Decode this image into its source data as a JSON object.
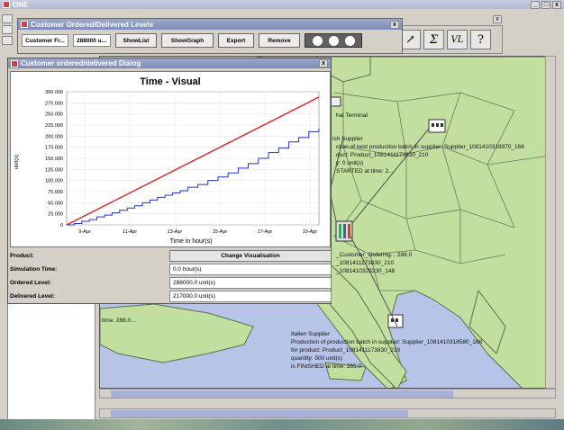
{
  "main_window": {
    "title": "ONE"
  },
  "toolbar_icons": [
    "↗",
    "Σ",
    "VL",
    "?"
  ],
  "customer_window": {
    "title": "Customer Ordered/Delivered Levels",
    "field1": "Customer Fr...",
    "field2": "288000 u...",
    "buttons": [
      "ShowList",
      "ShowGraph",
      "Export",
      "Remove"
    ]
  },
  "dialog": {
    "title": "Customer ordered/delivered Dialog",
    "fields": [
      {
        "label": "Product:",
        "value": "Change Visualisation"
      },
      {
        "label": "Simulation Time:",
        "value": "0.0 hour(s)"
      },
      {
        "label": "Ordered Level:",
        "value": "288000.0 unit(s)"
      },
      {
        "label": "Delivered Level:",
        "value": "217000.0 unit(s)"
      }
    ]
  },
  "chart_data": {
    "type": "line",
    "title": "Time - Visual",
    "xlabel": "Time in hour(s)",
    "ylabel": "unit(s)",
    "ylim": [
      0,
      300000
    ],
    "yticks": [
      "300.000",
      "275.000",
      "250.000",
      "225.000",
      "200.000",
      "175.000",
      "150.000",
      "125.000",
      "100.000",
      "75.000",
      "50.000",
      "25.000",
      "0"
    ],
    "xticks": [
      "9-Apr",
      "11-Apr",
      "13-Apr",
      "15-Apr",
      "17-Apr",
      "19-Apr"
    ],
    "grid": true,
    "series": [
      {
        "color": "#e02020",
        "points": [
          [
            0,
            0
          ],
          [
            1,
            288000
          ]
        ]
      },
      {
        "color": "#2030d0",
        "points": [
          [
            0,
            0
          ],
          [
            0.03,
            3000
          ],
          [
            0.06,
            8000
          ],
          [
            0.09,
            12000
          ],
          [
            0.12,
            18000
          ],
          [
            0.15,
            22000
          ],
          [
            0.18,
            27000
          ],
          [
            0.21,
            33000
          ],
          [
            0.24,
            38000
          ],
          [
            0.27,
            43000
          ],
          [
            0.3,
            50000
          ],
          [
            0.33,
            56000
          ],
          [
            0.36,
            62000
          ],
          [
            0.39,
            67000
          ],
          [
            0.42,
            72000
          ],
          [
            0.45,
            77000
          ],
          [
            0.48,
            85000
          ],
          [
            0.52,
            91000
          ],
          [
            0.56,
            100000
          ],
          [
            0.6,
            108000
          ],
          [
            0.64,
            117000
          ],
          [
            0.68,
            128000
          ],
          [
            0.72,
            138000
          ],
          [
            0.76,
            150000
          ],
          [
            0.8,
            163000
          ],
          [
            0.84,
            173000
          ],
          [
            0.88,
            187000
          ],
          [
            0.92,
            197000
          ],
          [
            0.96,
            210000
          ],
          [
            1,
            217000
          ]
        ]
      }
    ]
  },
  "map": {
    "labels": [
      "hal Terminal",
      "ish Supplier",
      "ction of next production batch in supplier: Supplier_1081410318970_168",
      "duct: Product_1081411173830_210",
      "y: 0 unit(s)",
      "STARTED at time: 2...",
      "_Customer_Ordering... 288.0",
      "_1081411173830_210",
      "_1081410329230_148",
      "time: 288.0...",
      "Italien Supplier",
      "Production of production batch in supplier: Supplier_1081410318580_168",
      "for product: Product_1081411173830_210",
      "quantity: 500 unit(s)",
      "is FINISHED at time: 265.0"
    ]
  },
  "colors": {
    "land": "#c3dfa0",
    "sea": "#b7c4e8",
    "border": "#5c6d4a"
  }
}
